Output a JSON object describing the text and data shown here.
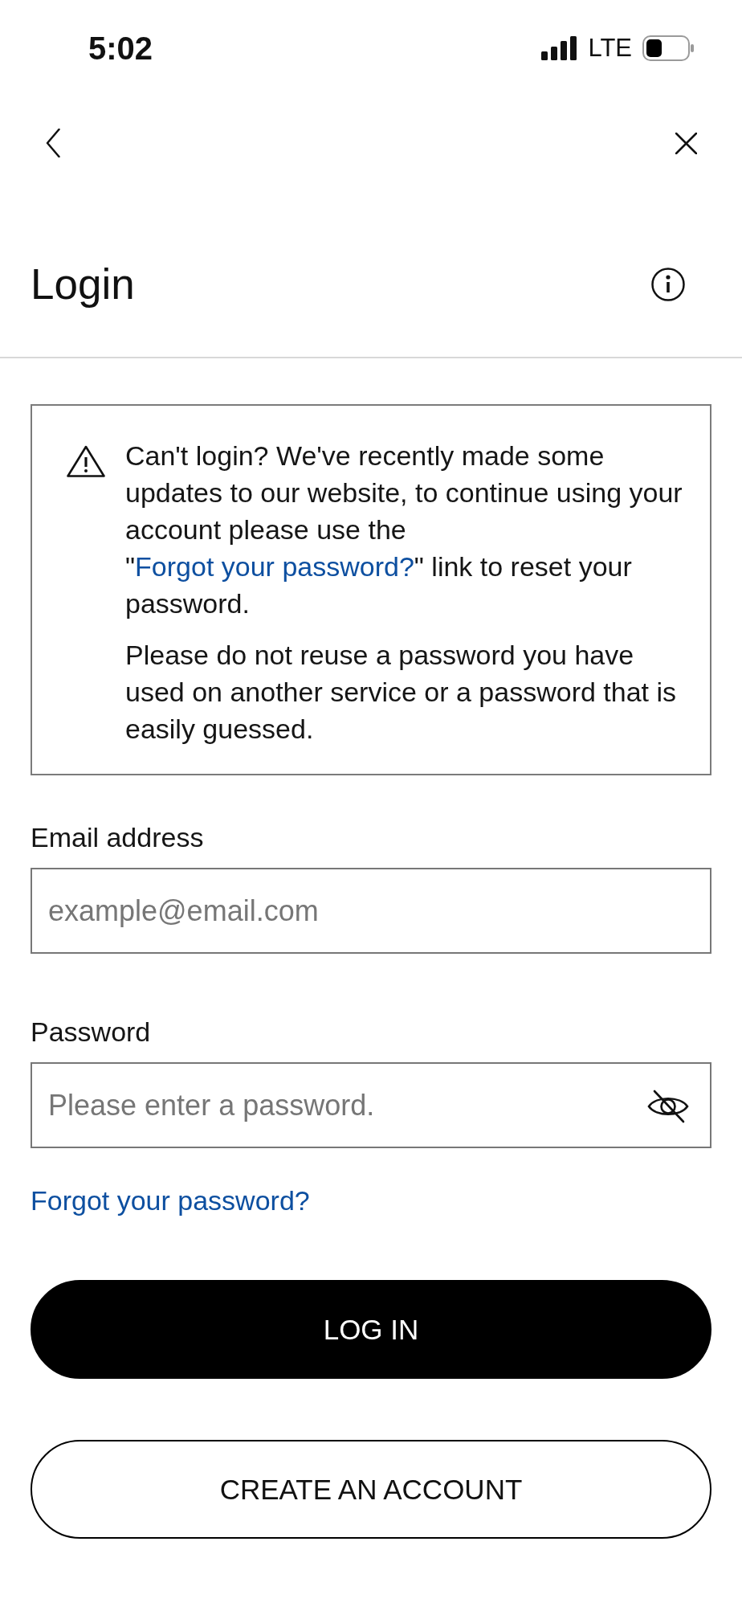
{
  "status_bar": {
    "time": "5:02",
    "network": "LTE"
  },
  "header": {
    "title": "Login"
  },
  "notice": {
    "paragraphs": [
      {
        "parts": [
          {
            "kind": "text",
            "text": "Can't login? We've recently made some updates to our website, to continue using your account please use the \""
          },
          {
            "kind": "link",
            "text": "Forgot your password?"
          },
          {
            "kind": "text",
            "text": "\" link to reset your password."
          }
        ]
      },
      {
        "parts": [
          {
            "kind": "text",
            "text": "Please do not reuse a password you have used on another service or a password that is easily guessed."
          }
        ]
      }
    ]
  },
  "form": {
    "fields": [
      {
        "kind": "email",
        "label": "Email address",
        "placeholder": "example@email.com"
      },
      {
        "kind": "password",
        "label": "Password",
        "placeholder": "Please enter a password."
      }
    ],
    "forgot_link": "Forgot your password?"
  },
  "buttons": [
    {
      "kind": "primary",
      "label": "LOG IN"
    },
    {
      "kind": "secondary",
      "label": "CREATE AN ACCOUNT"
    }
  ]
}
